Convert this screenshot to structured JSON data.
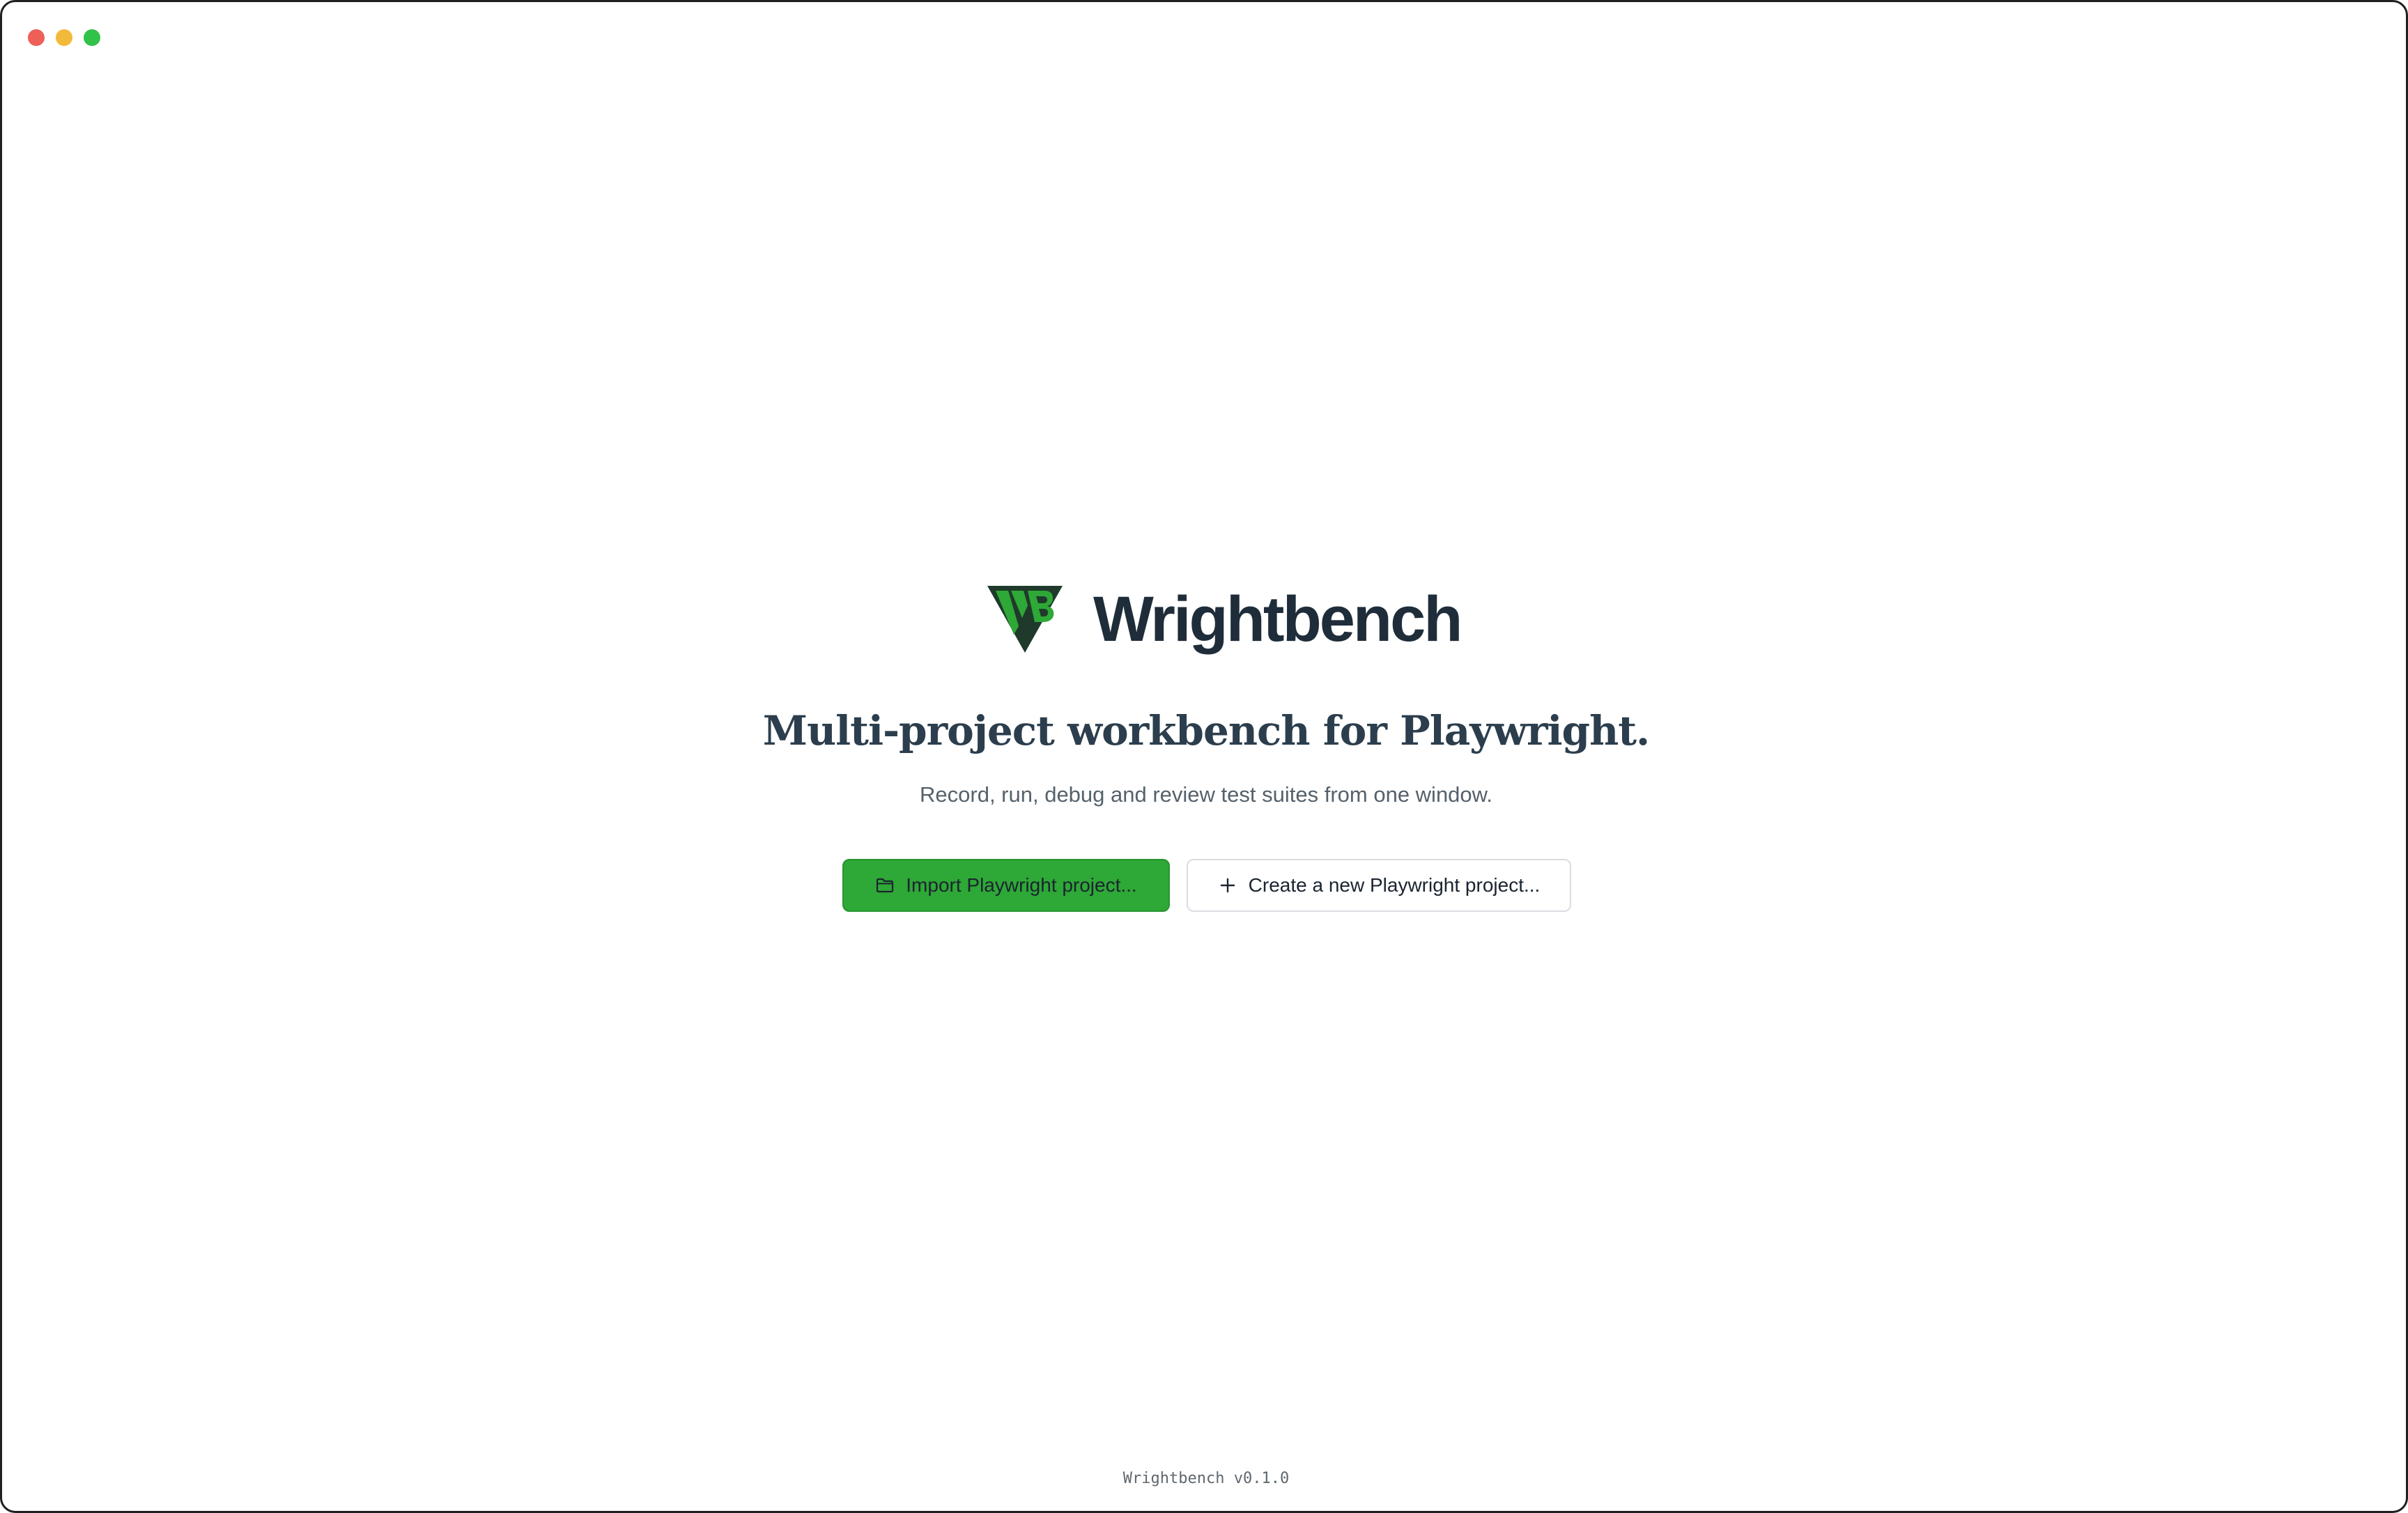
{
  "app": {
    "name": "Wrightbench",
    "headline": "Multi-project workbench for Playwright.",
    "tagline": "Record, run, debug and review test suites from one window.",
    "version": "Wrightbench v0.1.0"
  },
  "actions": {
    "import_label": "Import Playwright project...",
    "create_label": "Create a new Playwright project..."
  },
  "icons": {
    "import": "folder-icon",
    "create": "plus-icon",
    "logo": "wrightbench-logo"
  },
  "colors": {
    "primary": "#2ea836",
    "logo_green": "#2ea836",
    "logo_dark": "#1f3a2b",
    "brand_text": "#1f2d3a"
  }
}
